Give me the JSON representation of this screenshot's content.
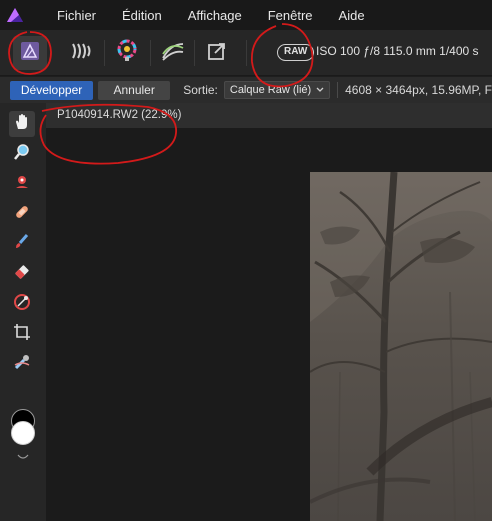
{
  "menu": {
    "items": [
      "Fichier",
      "Édition",
      "Affichage",
      "Fenêtre",
      "Aide"
    ]
  },
  "toolbar": {
    "personas": [
      "develop-persona-icon",
      "tone-mapping-persona-icon",
      "export-persona-icon",
      "photo-persona-icon"
    ],
    "raw_badge": "RAW",
    "exif": "ISO 100 ƒ/8 115.0 mm 1/400 s"
  },
  "context": {
    "develop_label": "Développer",
    "cancel_label": "Annuler",
    "output_label": "Sortie:",
    "output_value": "Calque Raw (lié)",
    "dimensions": "4608 × 3464px, 15.96MP, F"
  },
  "document": {
    "tab_title": "P1040914.RW2 (22.9%)"
  },
  "tools": [
    "hand-tool-icon",
    "zoom-tool-icon",
    "red-eye-tool-icon",
    "blemish-tool-icon",
    "overlay-paint-icon",
    "overlay-erase-icon",
    "overlay-gradient-icon",
    "crop-tool-icon",
    "white-balance-picker-icon"
  ],
  "colors": {
    "accent": "#2e63b8",
    "annotation": "#d31a1a",
    "primary_color": "#000000",
    "secondary_color": "#ffffff"
  }
}
